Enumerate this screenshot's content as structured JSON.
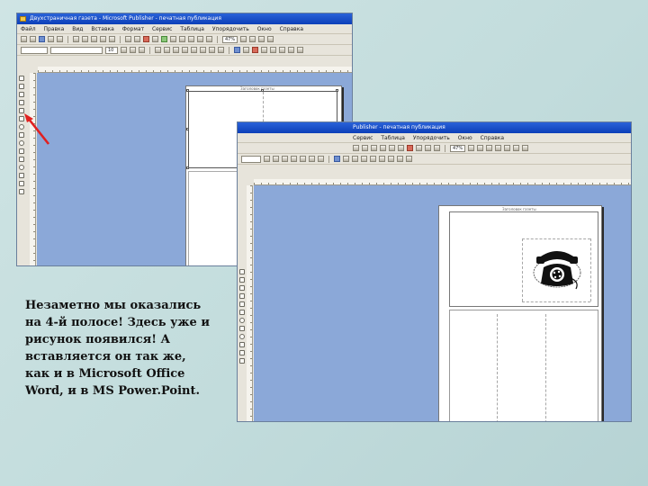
{
  "window_back": {
    "title": "Двухстраничная газета - Microsoft Publisher - печатная публикация",
    "menu": [
      "Файл",
      "Правка",
      "Вид",
      "Вставка",
      "Формат",
      "Сервис",
      "Таблица",
      "Упорядочить",
      "Окно",
      "Справка"
    ],
    "zoom": "47%",
    "font_size": "10",
    "page_header": "Заголовок газеты"
  },
  "window_front": {
    "title": "Publisher - печатная публикация",
    "menu": [
      "Сервис",
      "Таблица",
      "Упорядочить",
      "Окно",
      "Справка"
    ],
    "zoom": "47%",
    "page_header": "Заголовок газеты",
    "picture": "telephone-clipart"
  },
  "caption": {
    "lines": [
      "Незаметно мы оказались",
      "на 4-й полосе! Здесь уже и",
      "рисунок появился! А",
      "вставляется он так же,",
      "как и в Microsoft Office",
      "Word, и в MS Power.Point."
    ]
  },
  "colors": {
    "background": "#c4dcdc",
    "workspace": "#8ba8d8",
    "titlebar": "#1a4fcc",
    "arrow": "#e02020"
  }
}
